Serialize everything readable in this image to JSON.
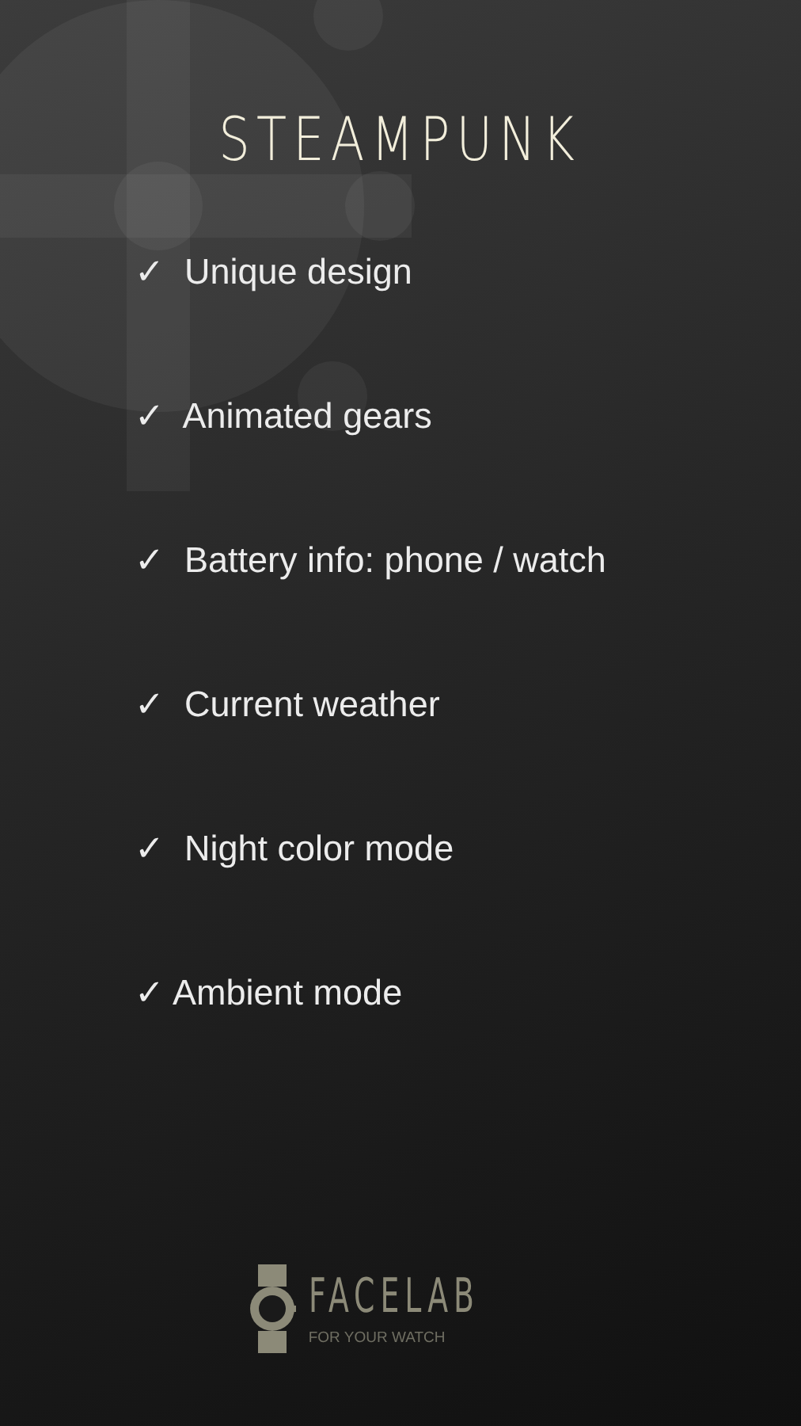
{
  "title": "STEAMPUNK",
  "features": [
    "✓  Unique design",
    "✓  Animated gears",
    "✓  Battery info: phone / watch",
    "✓  Current weather",
    "✓  Night color mode",
    "✓ Ambient mode"
  ],
  "brand": {
    "name": "FACELAB",
    "tagline": "FOR YOUR WATCH"
  }
}
